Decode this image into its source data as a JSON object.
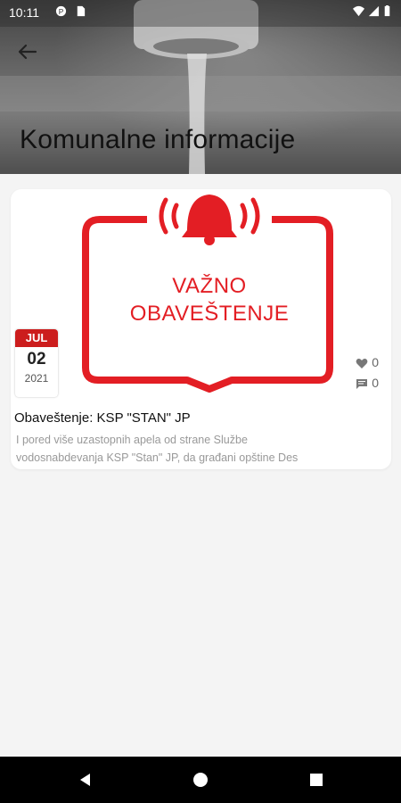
{
  "status": {
    "time": "10:11"
  },
  "header": {
    "title": "Komunalne informacije"
  },
  "post": {
    "hero_line1": "VAŽNO",
    "hero_line2": "OBAVEŠTENJE",
    "date": {
      "month": "JUL",
      "day": "02",
      "year": "2021"
    },
    "likes": "0",
    "comments": "0",
    "title": "Obaveštenje: KSP \"STAN\" JP",
    "excerpt_line1": "I pored više uzastopnih apela od strane Službe",
    "excerpt_line2": "vodosnabdevanja KSP \"Stan\" JP, da građani opštine Des"
  },
  "colors": {
    "accent": "#e31e24",
    "badge": "#cc1d1d"
  }
}
